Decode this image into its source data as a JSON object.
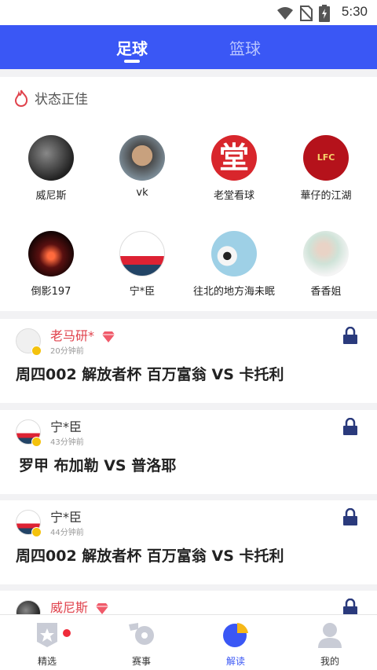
{
  "status": {
    "time": "5:30"
  },
  "tabs": [
    {
      "label": "足球"
    },
    {
      "label": "篮球"
    }
  ],
  "hot": {
    "title": "状态正佳",
    "experts": [
      {
        "name": "威尼斯"
      },
      {
        "name": "vk"
      },
      {
        "name": "老堂看球"
      },
      {
        "name": "華仔的江湖"
      },
      {
        "name": "倒影197"
      },
      {
        "name": "宁*臣"
      },
      {
        "name": "往北的地方海未眠"
      },
      {
        "name": "香香姐"
      }
    ],
    "avatar_glyphs": {
      "lao_tang": "堂",
      "lfc": "LFC"
    }
  },
  "cards": [
    {
      "author": "老马研*",
      "time": "20分钟前",
      "title": "周四002 解放者杯 百万富翁 VS 卡托利"
    },
    {
      "author": "宁*臣",
      "time": "43分钟前",
      "title": "罗甲 布加勒 VS 普洛耶"
    },
    {
      "author": "宁*臣",
      "time": "44分钟前",
      "title": "周四002 解放者杯 百万富翁 VS 卡托利"
    },
    {
      "author": "威尼斯",
      "time": "",
      "title": ""
    }
  ],
  "nav": [
    {
      "label": "精选"
    },
    {
      "label": "赛事"
    },
    {
      "label": "解读"
    },
    {
      "label": "我的"
    }
  ],
  "colors": {
    "brand": "#3a57f5",
    "red": "#e0424c",
    "navy": "#2a3a7c"
  }
}
